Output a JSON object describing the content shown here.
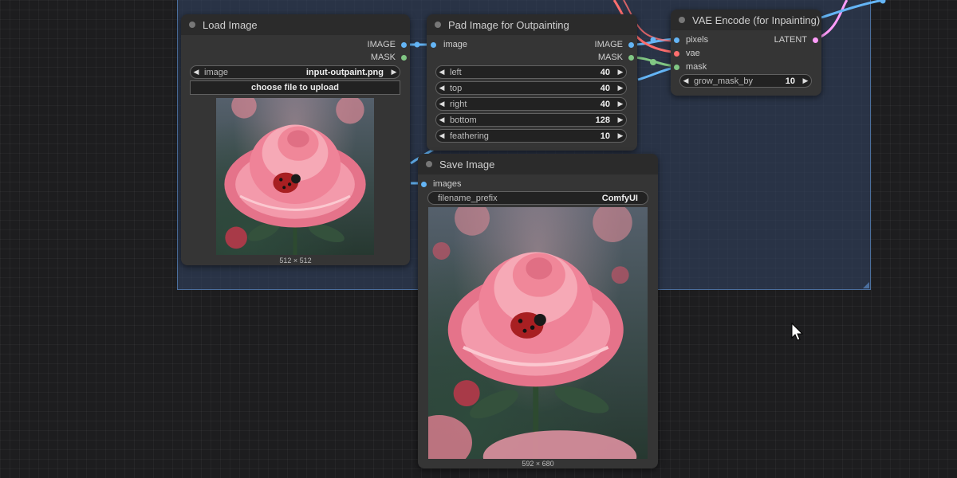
{
  "nodes": {
    "load_image": {
      "title": "Load Image",
      "outputs": [
        "IMAGE",
        "MASK"
      ],
      "image_widget": {
        "label": "image",
        "value": "input-outpaint.png"
      },
      "upload_label": "choose file to upload",
      "preview_size": "512 × 512"
    },
    "pad_image": {
      "title": "Pad Image for Outpainting",
      "input": "image",
      "outputs": [
        "IMAGE",
        "MASK"
      ],
      "widgets": [
        {
          "label": "left",
          "value": "40"
        },
        {
          "label": "top",
          "value": "40"
        },
        {
          "label": "right",
          "value": "40"
        },
        {
          "label": "bottom",
          "value": "128"
        },
        {
          "label": "feathering",
          "value": "10"
        }
      ]
    },
    "vae_encode": {
      "title": "VAE Encode (for Inpainting)",
      "inputs": [
        "pixels",
        "vae",
        "mask"
      ],
      "output": "LATENT",
      "widget": {
        "label": "grow_mask_by",
        "value": "10"
      }
    },
    "save_image": {
      "title": "Save Image",
      "input": "images",
      "widget": {
        "label": "filename_prefix",
        "value": "ComfyUI"
      },
      "preview_size": "592 × 680"
    }
  },
  "colors": {
    "image_slot": "#64b5f6",
    "mask_slot": "#81c784",
    "vae_slot": "#ff6e6e",
    "latent_slot": "#ff9cf9",
    "group_fill": "#334666"
  }
}
